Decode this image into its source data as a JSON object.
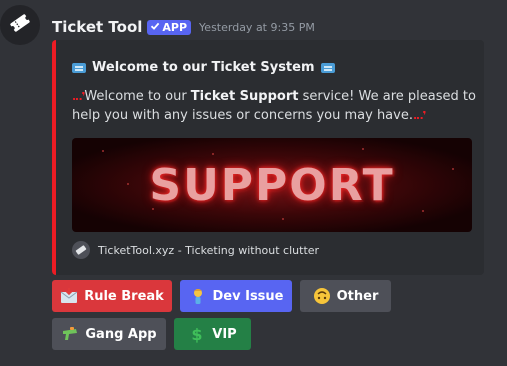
{
  "author": {
    "name": "Ticket Tool",
    "tag": "APP",
    "timestamp": "Yesterday at 9:35 PM",
    "avatar_icon": "ticket-icon"
  },
  "embed": {
    "accent_color": "#ed1c24",
    "title": "Welcome to our Ticket System",
    "title_icon": "ticket-emoji-icon",
    "description_before": "Welcome to our ",
    "description_bold": "Ticket Support",
    "description_after": " service! We are pleased to help you with any issues or concerns you may have.",
    "image_text": "SUPPORT",
    "footer_icon": "tickettool-logo-icon",
    "footer_text": "TicketTool.xyz - Ticketing without clutter"
  },
  "buttons": [
    {
      "label": "Rule Break",
      "style": "danger",
      "icon": "incoming-envelope-icon"
    },
    {
      "label": "Dev Issue",
      "style": "primary",
      "icon": "person-icon"
    },
    {
      "label": "Other",
      "style": "secondary",
      "icon": "upside-down-face-icon"
    },
    {
      "label": "Gang App",
      "style": "secondary",
      "icon": "water-pistol-icon"
    },
    {
      "label": "VIP",
      "style": "success",
      "icon": "dollar-sign-icon"
    }
  ],
  "colors": {
    "background": "#313338",
    "embed_background": "#2b2d31",
    "app_tag": "#5865f2",
    "danger": "#da373c",
    "primary": "#5865f2",
    "secondary": "#4e5058",
    "success": "#248046"
  }
}
